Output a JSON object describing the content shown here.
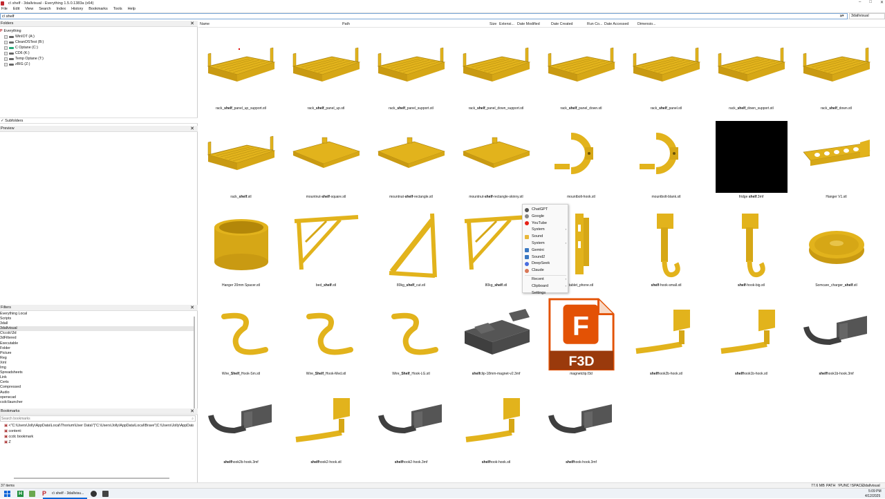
{
  "window": {
    "title": "c\\ shelf - 3dallvisual - Everything 1.5.0.1383a (x64)",
    "min": "–",
    "max": "□",
    "close": "✕"
  },
  "menu": [
    "File",
    "Edit",
    "View",
    "Search",
    "Index",
    "History",
    "Bookmarks",
    "Tools",
    "Help"
  ],
  "search": {
    "value": "c\\ shelf",
    "clear": "✕",
    "filter_value": "3dallvisual"
  },
  "folders": {
    "header": "Folders",
    "close": "✕",
    "root": "Everything",
    "drives": [
      "WinIOT (A:)",
      "CleanOSTest (B:)",
      "C Optane (C:)",
      "CD6 (K:)",
      "Temp Optane (T:)",
      "zBIG (Z:)"
    ]
  },
  "subfolders": {
    "check": "✓",
    "label": "Subfolders"
  },
  "preview": {
    "header": "Preview",
    "close": "✕"
  },
  "filters": {
    "header": "Filters",
    "close": "✕",
    "items": [
      "Everything Local",
      "Scripts",
      "3dall",
      "3dallvisual",
      "C\\ccdc\\3d",
      "3dFiltered",
      "Executable",
      "Folder",
      "Picture",
      "Reg",
      "Xml",
      "Img",
      "Spreadsheets",
      "Link",
      "Certs",
      "Compressed",
      "Audio",
      "openscad",
      "ccdc\\launcher"
    ],
    "selected": 3
  },
  "bookmarks": {
    "header": "Bookmarks",
    "close": "✕",
    "search_placeholder": "Search bookmarks",
    "search_icon": "magnifier",
    "items": [
      "<\"C:\\Users\\Jolly\\AppData\\Local\\Thorium\\User Data\\\"|\"C:\\Users\\Jolly\\AppData\\Local\\Brave\"|C:\\Users\\Jolly\\AppData\\Local",
      "content:",
      "ccdc bookmark",
      "Z"
    ]
  },
  "columns": [
    "Name",
    "Path",
    "Size",
    "Extensi...",
    "Date Modified",
    "Date Created",
    "Run Co...",
    "Date Accessed",
    "Dimensio..."
  ],
  "files": [
    {
      "pre": "rack_",
      "bold": "shelf",
      "post": "_panel_up_support.stl",
      "type": "rack"
    },
    {
      "pre": "rack_",
      "bold": "shelf",
      "post": "_panel_up.stl",
      "type": "rack"
    },
    {
      "pre": "rack_",
      "bold": "shelf",
      "post": "_panel_support.stl",
      "type": "rack"
    },
    {
      "pre": "rack_",
      "bold": "shelf",
      "post": "_panel_down_support.stl",
      "type": "rack"
    },
    {
      "pre": "rack_",
      "bold": "shelf",
      "post": "_panel_down.stl",
      "type": "rack"
    },
    {
      "pre": "rack_",
      "bold": "shelf",
      "post": "_panel.stl",
      "type": "rack"
    },
    {
      "pre": "rack_",
      "bold": "shelf",
      "post": "_down_support.stl",
      "type": "rack"
    },
    {
      "pre": "rack_",
      "bold": "shelf",
      "post": "_down.stl",
      "type": "rack"
    },
    {
      "pre": "rack_",
      "bold": "shelf",
      "post": ".stl",
      "type": "rack"
    },
    {
      "pre": "mountnut-",
      "bold": "shelf",
      "post": "-square.stl",
      "type": "plate"
    },
    {
      "pre": "mountnut-",
      "bold": "shelf",
      "post": "-rectangle.stl",
      "type": "plate"
    },
    {
      "pre": "mountnut-",
      "bold": "shelf",
      "post": "-rectangle-skinny.stl",
      "type": "plate"
    },
    {
      "pre": "mountbolt-hook.stl",
      "bold": "",
      "post": "",
      "type": "clamp"
    },
    {
      "pre": "mountbolt-blank.stl",
      "bold": "",
      "post": "",
      "type": "clamp"
    },
    {
      "pre": "fridge ",
      "bold": "shelf",
      "post": ".3mf",
      "type": "black"
    },
    {
      "pre": "Hanger V1.stl",
      "bold": "",
      "post": "",
      "type": "hanger"
    },
    {
      "pre": "Hanger 20mm Spacer.stl",
      "bold": "",
      "post": "",
      "type": "cylinder"
    },
    {
      "pre": "bed_",
      "bold": "shelf",
      "post": ".stl",
      "type": "bracket"
    },
    {
      "pre": "80kg_",
      "bold": "shelf",
      "post": "_cut.stl",
      "type": "bracket2"
    },
    {
      "pre": "80kg_",
      "bold": "shelf",
      "post": ".stl",
      "type": "bracket"
    },
    {
      "pre": "tablet_phone.stl",
      "bold": "",
      "post": "",
      "type": "tablet"
    },
    {
      "pre": "",
      "bold": "shelf",
      "post": "-hook-small.stl",
      "type": "hookv"
    },
    {
      "pre": "",
      "bold": "shelf",
      "post": "-hook-big.stl",
      "type": "hookv"
    },
    {
      "pre": "Somcare_charger_",
      "bold": "shelf",
      "post": ".stl",
      "type": "dish"
    },
    {
      "pre": "Wire_",
      "bold": "Shelf",
      "post": "_Hook-Sm.stl",
      "type": "wire"
    },
    {
      "pre": "Wire_",
      "bold": "Shelf",
      "post": "_Hook-Med.stl",
      "type": "wire"
    },
    {
      "pre": "Wire_",
      "bold": "Shelf",
      "post": "_Hook-LG.stl",
      "type": "wire"
    },
    {
      "pre": "",
      "bold": "shelf",
      "post": "clip-18mm-magnet-v2.3mf",
      "type": "clip"
    },
    {
      "pre": "magnetclip.f3d",
      "bold": "",
      "post": "",
      "type": "f3d"
    },
    {
      "pre": "",
      "bold": "shelf",
      "post": "hook2b-hook.stl",
      "type": "hookl"
    },
    {
      "pre": "",
      "bold": "shelf",
      "post": "hook1b-hook.stl",
      "type": "hookl"
    },
    {
      "pre": "",
      "bold": "shelf",
      "post": "hook1b-hook.3mf",
      "type": "hookd"
    },
    {
      "pre": "",
      "bold": "shelf",
      "post": "hook2b-hook.3mf",
      "type": "hookd"
    },
    {
      "pre": "",
      "bold": "shelf",
      "post": "hook2-hook.stl",
      "type": "hookl"
    },
    {
      "pre": "",
      "bold": "shelf",
      "post": "hook2-hook.3mf",
      "type": "hookd"
    },
    {
      "pre": "",
      "bold": "shelf",
      "post": "hook-hook.stl",
      "type": "hookl"
    },
    {
      "pre": "",
      "bold": "shelf",
      "post": "hook-hook.3mf",
      "type": "hookd"
    }
  ],
  "f3d_label": "F3D",
  "context_menu": [
    {
      "label": "ChatGPT",
      "icon": "chatgpt",
      "color": "#555"
    },
    {
      "label": "Google",
      "icon": "google",
      "color": "#888"
    },
    {
      "label": "YouTube",
      "icon": "youtube",
      "color": "#e62117"
    },
    {
      "label": "System",
      "icon": "",
      "color": "",
      "arrow": "›"
    },
    {
      "label": "Sound",
      "icon": "folder",
      "color": "#e8b73a"
    },
    {
      "label": "System",
      "icon": "",
      "color": "",
      "arrow": "›"
    },
    {
      "label": "Gemini",
      "icon": "app",
      "color": "#3a78c2"
    },
    {
      "label": "Sound2",
      "icon": "app",
      "color": "#3a78c2"
    },
    {
      "label": "DeepSeek",
      "icon": "deepseek",
      "color": "#4a6ee0"
    },
    {
      "label": "Claude",
      "icon": "claude",
      "color": "#d97757"
    },
    {
      "label": "Recent",
      "icon": "",
      "color": "",
      "arrow": "›"
    },
    {
      "label": "Clipboard",
      "icon": "",
      "color": "",
      "arrow": "›"
    },
    {
      "label": "Settings",
      "icon": "",
      "color": ""
    }
  ],
  "status": {
    "count": "37 items",
    "size": "77.6 MB",
    "flags": [
      "PATH",
      "!PUNC",
      "!SPACE"
    ],
    "filter": "3dallvisual"
  },
  "taskbar": {
    "task_label": "c\\ shelf - 3dallvisu...",
    "time": "5:09 PM",
    "date": "4/12/2025"
  },
  "colors": {
    "yellow": "#e2b31c",
    "dark": "#4a4a4a",
    "f3d": "#e35205"
  }
}
